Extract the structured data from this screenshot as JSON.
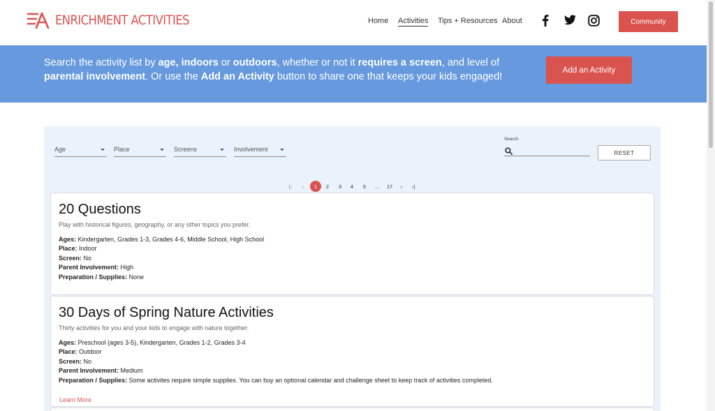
{
  "brand": {
    "name": "ENRICHMENT ACTIVITIES",
    "color": "#d9534f"
  },
  "nav": {
    "items": [
      "Home",
      "Activities",
      "Tips + Resources",
      "About"
    ],
    "active": "Activities"
  },
  "social": [
    "facebook-icon",
    "twitter-icon",
    "instagram-icon"
  ],
  "community_label": "Community",
  "banner": {
    "bg": "#6699dd",
    "t1": "Search the activity list by ",
    "b1": "age, indoors",
    "t2": " or ",
    "b2": "outdoors",
    "t3": ", whether or not it ",
    "b3": "requires a screen",
    "t4": ", and level of ",
    "b4": "parental involvement",
    "t5": ". Or use the ",
    "b5": "Add an Activity",
    "t6": " button to share one that keeps your kids engaged!",
    "button_label": "Add an Activity"
  },
  "filters": {
    "age": "Age",
    "place": "Place",
    "screens": "Screens",
    "involvement": "Involvement"
  },
  "search": {
    "label": "Search",
    "value": "",
    "placeholder": ""
  },
  "reset_label": "RESET",
  "pagination": {
    "first": "|‹",
    "prev": "‹",
    "pages": [
      "1",
      "2",
      "3",
      "4",
      "5",
      "...",
      "17"
    ],
    "current": "1",
    "next": "›",
    "last": "›|"
  },
  "field_labels": {
    "ages": "Ages:",
    "place": "Place:",
    "screen": "Screen:",
    "involvement": "Parent Involvement:",
    "prep": "Preparation / Supplies:"
  },
  "activities": [
    {
      "title": "20 Questions",
      "description": "Play with historical figures, geography, or any other topics you prefer.",
      "ages": "Kindergarten, Grades 1-3, Grades 4-6, Middle School, High School",
      "place": "Indoor",
      "screen": "No",
      "involvement": "High",
      "prep": "None"
    },
    {
      "title": "30 Days of Spring Nature Activities",
      "description": "Thirty activities for you and your kids to engage with nature together.",
      "ages": "Preschool (ages 3-5), Kindergarten, Grades 1-2, Grades 3-4",
      "place": "Outdoor",
      "screen": "No",
      "involvement": "Medium",
      "prep": "Some activites require simple supplies. You can buy an optional calendar and challenge sheet to keep track of activities completed.",
      "link": "Learn More"
    }
  ]
}
